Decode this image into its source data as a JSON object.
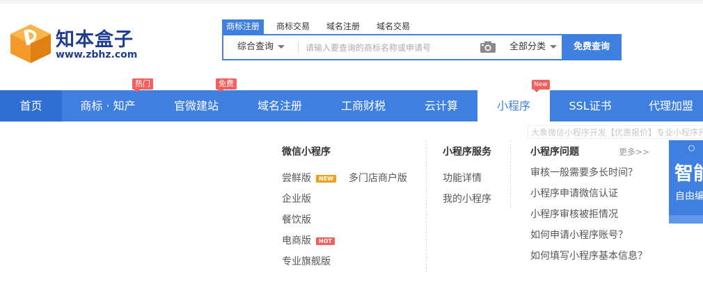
{
  "logo": {
    "name": "知本盒子",
    "url": "www.zbhz.com"
  },
  "search": {
    "tabs": [
      {
        "label": "商标注册",
        "active": true
      },
      {
        "label": "商标交易",
        "active": false
      },
      {
        "label": "域名注册",
        "active": false
      },
      {
        "label": "域名交易",
        "active": false
      }
    ],
    "type_select": "综合查询",
    "placeholder": "请输入要查询的商标名称或申请号",
    "category_select": "全部分类",
    "button": "免费查询"
  },
  "nav": {
    "items": [
      {
        "label": "首页"
      },
      {
        "label": "商标 · 知产",
        "badge": "热门"
      },
      {
        "label": "官微建站",
        "badge": "免费"
      },
      {
        "label": "域名注册"
      },
      {
        "label": "工商财税"
      },
      {
        "label": "云计算"
      },
      {
        "label": "小程序",
        "badge": "New",
        "active": true
      },
      {
        "label": "SSL证书"
      },
      {
        "label": "代理加盟"
      }
    ]
  },
  "tooltip": "大象微信小程序开发【优惠报价】专业小程序开发",
  "dropdown": {
    "wechat": {
      "title": "微信小程序",
      "items": [
        {
          "label": "尝鲜版",
          "tag": "NEW"
        },
        {
          "label": "多门店商户版"
        },
        {
          "label": "企业版"
        },
        {
          "label": "餐饮版"
        },
        {
          "label": "电商版",
          "tag": "HOT"
        },
        {
          "label": "专业旗舰版"
        }
      ]
    },
    "service": {
      "title": "小程序服务",
      "items": [
        {
          "label": "功能详情"
        },
        {
          "label": "我的小程序"
        }
      ]
    },
    "faq": {
      "title": "小程序问题",
      "more": "更多>>",
      "items": [
        {
          "label": "审核一般需要多长时间？"
        },
        {
          "label": "小程序申请微信认证"
        },
        {
          "label": "小程序审核被拒情况"
        },
        {
          "label": "如何申请小程序账号？"
        },
        {
          "label": "如何填写小程序基本信息？"
        }
      ]
    }
  },
  "promo": {
    "title": "智能",
    "subtitle": "自由编"
  },
  "colors": {
    "accent": "#3e7fe0",
    "brand_dark": "#1f3c93",
    "logo_orange": "#f39a2b",
    "badge_red": "#f25f5c",
    "tag_orange": "#f0a020"
  }
}
